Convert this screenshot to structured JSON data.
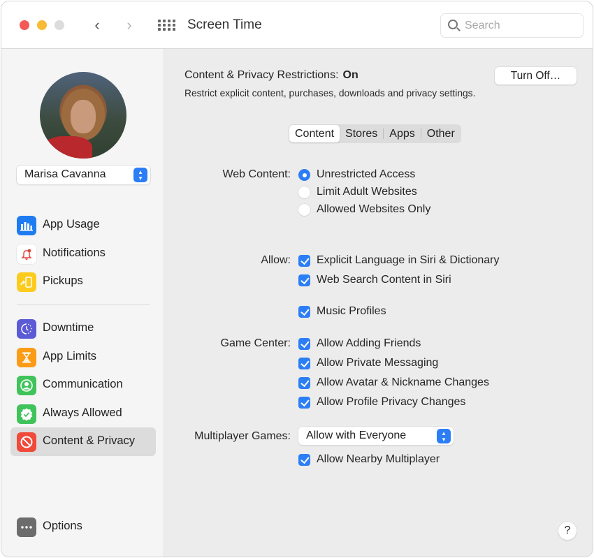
{
  "window": {
    "title": "Screen Time",
    "search": {
      "placeholder": "Search",
      "value": ""
    }
  },
  "sidebar": {
    "user": {
      "name": "Marisa Cavanna"
    },
    "items_top": [
      {
        "label": "App Usage",
        "icon": "bar-chart-icon",
        "color": "#1e7cf2"
      },
      {
        "label": "Notifications",
        "icon": "bell-icon",
        "color": "#ffffff"
      },
      {
        "label": "Pickups",
        "icon": "pickup-phone-icon",
        "color": "#fccb1e"
      }
    ],
    "items_bottom": [
      {
        "label": "Downtime",
        "icon": "downtime-icon",
        "color": "#5b5bd6"
      },
      {
        "label": "App Limits",
        "icon": "hourglass-icon",
        "color": "#fb9b16"
      },
      {
        "label": "Communication",
        "icon": "contact-icon",
        "color": "#3fc35a"
      },
      {
        "label": "Always Allowed",
        "icon": "checkmark-badge-icon",
        "color": "#3fc35a"
      },
      {
        "label": "Content & Privacy",
        "icon": "prohibited-icon",
        "color": "#ef4a3a",
        "selected": true
      }
    ],
    "options": {
      "label": "Options",
      "icon": "ellipsis-icon"
    }
  },
  "main": {
    "header": {
      "label": "Content & Privacy Restrictions:",
      "status": "On"
    },
    "subtitle": "Restrict explicit content, purchases, downloads and privacy settings.",
    "turn_off_button": "Turn Off…",
    "tabs": [
      {
        "label": "Content",
        "active": true
      },
      {
        "label": "Stores"
      },
      {
        "label": "Apps"
      },
      {
        "label": "Other"
      }
    ],
    "web_content": {
      "label": "Web Content:",
      "options": [
        {
          "label": "Unrestricted Access",
          "selected": true
        },
        {
          "label": "Limit Adult Websites",
          "selected": false
        },
        {
          "label": "Allowed Websites Only",
          "selected": false
        }
      ]
    },
    "allow": {
      "label": "Allow:",
      "options": [
        {
          "label": "Explicit Language in Siri & Dictionary",
          "checked": true
        },
        {
          "label": "Web Search Content in Siri",
          "checked": true
        },
        {
          "label": "Music Profiles",
          "checked": true
        }
      ]
    },
    "game_center": {
      "label": "Game Center:",
      "options": [
        {
          "label": "Allow Adding Friends",
          "checked": true
        },
        {
          "label": "Allow Private Messaging",
          "checked": true
        },
        {
          "label": "Allow Avatar & Nickname Changes",
          "checked": true
        },
        {
          "label": "Allow Profile Privacy Changes",
          "checked": true
        }
      ]
    },
    "multiplayer": {
      "label": "Multiplayer Games:",
      "selected": "Allow with Everyone",
      "nearby": {
        "label": "Allow Nearby Multiplayer",
        "checked": true
      }
    },
    "help": "?"
  },
  "colors": {
    "accent": "#2c7ef6",
    "selected_row": "#dcdcdc"
  }
}
